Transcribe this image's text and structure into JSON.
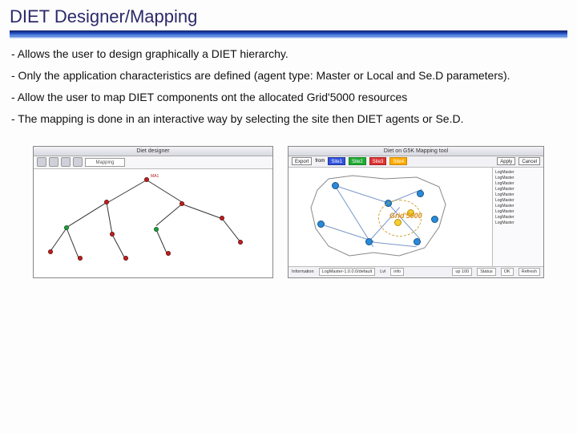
{
  "header": {
    "title": "DIET Designer/Mapping"
  },
  "bullets": [
    " - Allows the user to design graphically a DIET hierarchy.",
    " - Only the application characteristics are defined (agent type: Master or Local and Se.D parameters).",
    " - Allow the user to map DIET components ont the allocated Grid'5000 resources",
    " - The mapping is done in an interactive way by selecting the site then DIET agents or Se.D."
  ],
  "fig1": {
    "window_title": "Diet designer",
    "dropdown": "Mapping",
    "root_label": "MA1"
  },
  "fig2": {
    "window_title": "Diet on G5K Mapping tool",
    "toolbar": {
      "export": "Export",
      "from": "from",
      "sites": [
        "Site1",
        "Site2",
        "Site3",
        "Site4"
      ],
      "apply": "Apply",
      "cancel": "Cancel"
    },
    "grid_label": "Grid'5000",
    "side_items": [
      "LogMaster",
      "LogMaster",
      "LogMaster",
      "LogMaster",
      "LogMaster",
      "LogMaster",
      "LogMaster",
      "LogMaster",
      "LogMaster",
      "LogMaster"
    ],
    "status": {
      "left_label": "Information",
      "left_value": "LogMaster-1.0.0.0/default",
      "mid_label": "Lvl",
      "mid_value": "info",
      "r1": "up 100",
      "r2": "Status",
      "r3": "OK",
      "r4": "Refresh"
    }
  }
}
